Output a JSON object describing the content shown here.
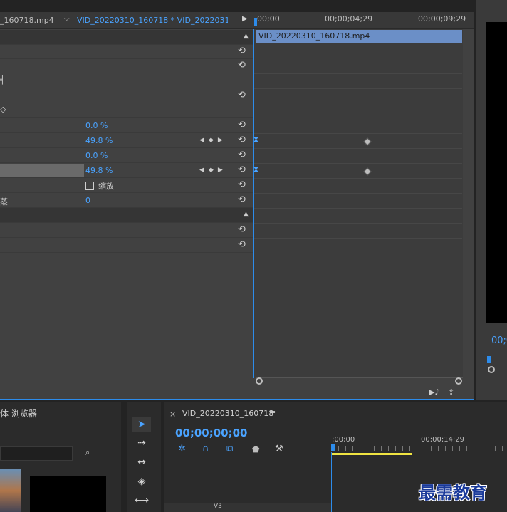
{
  "effect_controls": {
    "source_tab": "_160718.mp4",
    "sequence_tab": "VID_20220310_160718 * VID_20220310_...",
    "timecodes": [
      "00;00",
      "00;00;04;29",
      "00;00;09;29"
    ],
    "clip_name": "VID_20220310_160718.mp4",
    "values": {
      "v1": "0.0 %",
      "v2": "49.8 %",
      "v3": "0.0 %",
      "v4": "49.8 %",
      "scale_label": "缩放",
      "v5": "0"
    },
    "partial_label": "蒸"
  },
  "media_browser": {
    "title": "体 浏览器"
  },
  "sequence": {
    "title": "VID_20220310_160718",
    "timecode": "00;00;00;00",
    "ruler_start": ";00;00",
    "ruler_mid": "00;00;14;29",
    "track_label": "V3"
  },
  "program": {
    "timecode": "00;0"
  },
  "watermark": "最需教育",
  "colors": {
    "accent": "#2d8ceb",
    "value_blue": "#4aa3ff",
    "clip_bar": "#6b8fc7",
    "work_area": "#f0e442"
  }
}
